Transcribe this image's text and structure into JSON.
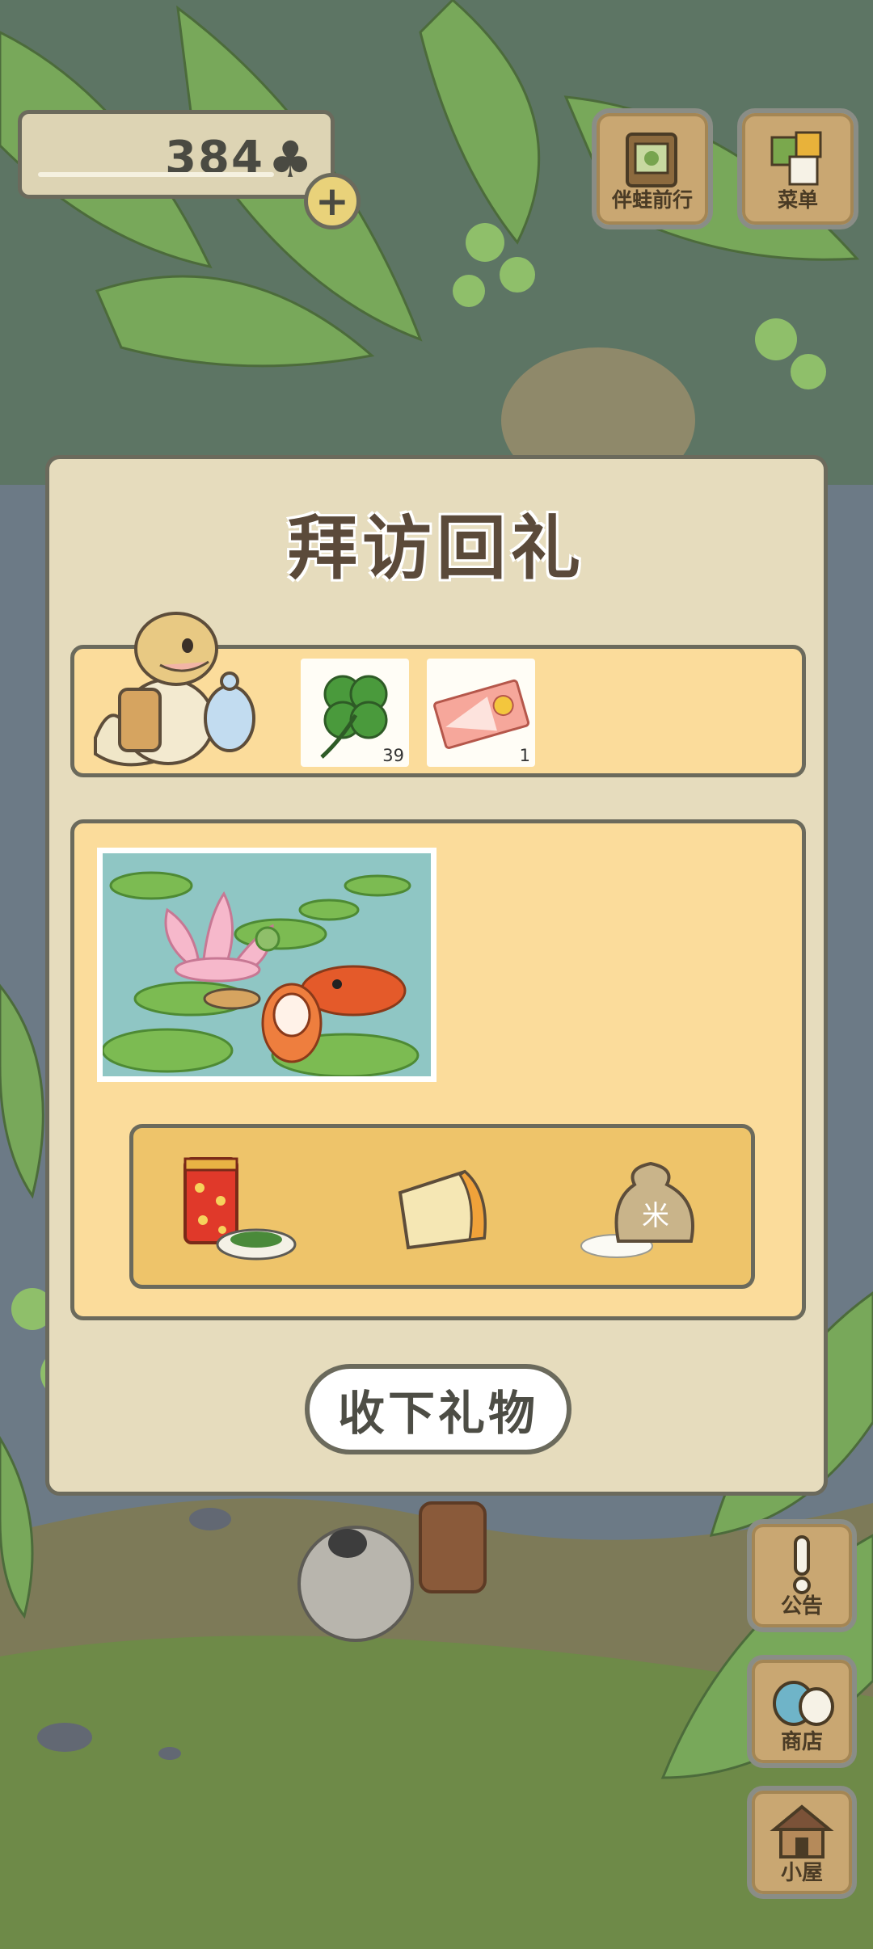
{
  "hud": {
    "clover_count": "384",
    "clover_icon": "clover-icon",
    "add_icon": "plus-icon",
    "buttons": [
      {
        "label": "伴蛙前行",
        "icon": "album-icon"
      },
      {
        "label": "菜单",
        "icon": "menu-cards-icon"
      }
    ]
  },
  "dialog": {
    "title": "拜访回礼",
    "visitor_icon": "lizard-visitor-icon",
    "rewards": [
      {
        "icon": "four-leaf-clover-icon",
        "quantity": "39"
      },
      {
        "icon": "ticket-icon",
        "quantity": "1"
      }
    ],
    "postcard_icon": "pond-koi-lotus-postcard",
    "gifts": [
      {
        "icon": "tea-canister-with-leaves-icon"
      },
      {
        "icon": "cheese-icon"
      },
      {
        "icon": "rice-sack-icon",
        "text": "米"
      }
    ],
    "accept_label": "收下礼物"
  },
  "side_menu": [
    {
      "label": "公告",
      "icon": "exclamation-icon"
    },
    {
      "label": "商店",
      "icon": "shop-bags-icon"
    },
    {
      "label": "小屋",
      "icon": "house-icon"
    }
  ],
  "colors": {
    "panel": "#e6dcbd",
    "strip": "#fbdc9b",
    "tray": "#eec46a",
    "border": "#6b6a5c",
    "wood": "#c9a772"
  }
}
